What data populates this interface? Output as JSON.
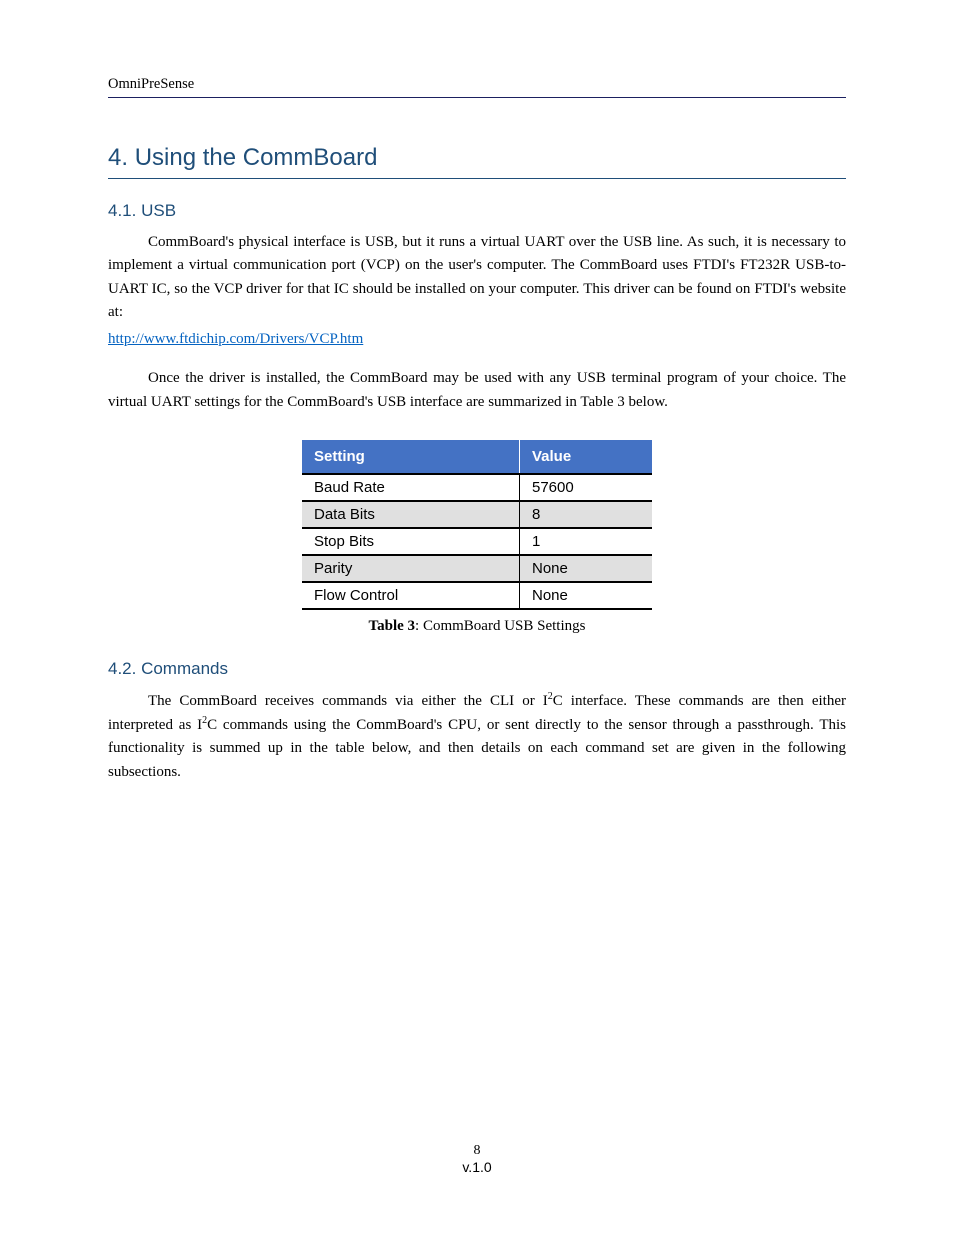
{
  "header": {
    "running_title": "OmniPreSense"
  },
  "section": {
    "number": "4.",
    "title": "Using the CommBoard"
  },
  "usb": {
    "heading": "4.1. USB",
    "p1": "CommBoard's physical interface is USB, but it runs a virtual UART over the USB line.  As such, it is necessary to implement a virtual communication port (VCP) on the user's computer.  The CommBoard uses FTDI's FT232R USB-to-UART IC, so the VCP driver for that IC should be installed on your computer.  This driver can be found on FTDI's website at:",
    "link": "http://www.ftdichip.com/Drivers/VCP.htm",
    "p2": "Once the driver is installed, the CommBoard may be used with any USB terminal program of your choice.  The virtual UART settings for the CommBoard's USB interface are summarized in Table 3 below."
  },
  "table": {
    "caption_label": "Table 3",
    "caption_text": ": CommBoard USB Settings",
    "headers": [
      "Setting",
      "Value"
    ],
    "rows": [
      [
        "Baud Rate",
        "57600"
      ],
      [
        "Data Bits",
        "8"
      ],
      [
        "Stop Bits",
        "1"
      ],
      [
        "Parity",
        "None"
      ],
      [
        "Flow Control",
        "None"
      ]
    ]
  },
  "commands": {
    "heading": "4.2. Commands",
    "p1_a": "The CommBoard receives commands via either the CLI or I",
    "p1_sup": "2",
    "p1_b": "C interface.  These commands are then either interpreted as I",
    "p1_c": "C commands using the CommBoard's CPU, or sent directly to the sensor through a passthrough.  This functionality is summed up in the table below, and then details on each command set are given in the following subsections."
  },
  "page_number": "8",
  "version": "v.1.0"
}
